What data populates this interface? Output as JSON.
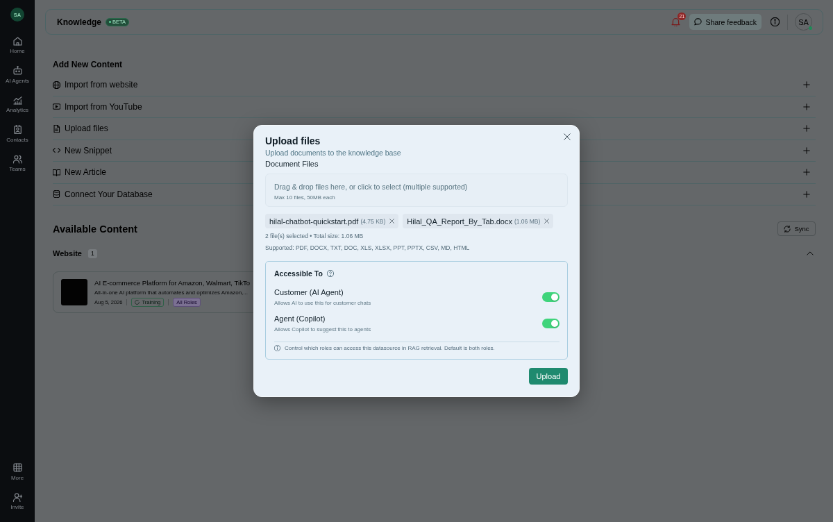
{
  "sidebar": {
    "avatar": "SA",
    "items": [
      {
        "label": "Home"
      },
      {
        "label": "AI Agents"
      },
      {
        "label": "Analytics"
      },
      {
        "label": "Contacts"
      },
      {
        "label": "Teams"
      }
    ],
    "bottom_items": [
      {
        "label": "More"
      },
      {
        "label": "Invite"
      }
    ]
  },
  "header": {
    "title": "Knowledge",
    "badge": "BETA",
    "notification_count": "21",
    "feedback_button": "Share feedback",
    "avatar": "SA",
    "online": true
  },
  "add_content": {
    "title": "Add New Content",
    "options": [
      {
        "label": "Import from website"
      },
      {
        "label": "Import from YouTube"
      },
      {
        "label": "Upload files"
      },
      {
        "label": "New Snippet"
      },
      {
        "label": "New Article"
      },
      {
        "label": "Connect Your Database"
      }
    ]
  },
  "available_content": {
    "title": "Available Content",
    "sync_button": "Sync",
    "groups": [
      {
        "label": "Website",
        "count": "1",
        "expanded": true,
        "items": [
          {
            "title": "AI E-commerce Platform for Amazon, Walmart, TikTo",
            "description": "All-in-one AI platform that automates and optimizes Amazon,...",
            "date": "Aug 5, 2026",
            "status": "Training",
            "role": "All Roles"
          }
        ]
      }
    ]
  },
  "dialog": {
    "title": "Upload files",
    "subtitle": "Upload documents to the knowledge base",
    "field_label": "Document Files",
    "dropzone": {
      "text": "Drag & drop files here, or click to select (multiple supported)",
      "hint": "Max 10 files, 50MB each"
    },
    "files": [
      {
        "name": "hilal-chatbot-quickstart.pdf",
        "size": "(4.75 KB)"
      },
      {
        "name": "Hilal_QA_Report_By_Tab.docx",
        "size": "(1.06 MB)"
      }
    ],
    "summary": "2 file(s) selected • Total size: 1.06 MB",
    "supported": "Supported: PDF, DOCX, TXT, DOC, XLS, XLSX, PPT, PPTX, CSV, MD, HTML",
    "access": {
      "title": "Accessible To",
      "roles": [
        {
          "name": "Customer (AI Agent)",
          "description": "Allows AI to use this for customer chats",
          "on": true
        },
        {
          "name": "Agent (Copilot)",
          "description": "Allows Copilot to suggest this to agents",
          "on": true
        }
      ],
      "note": "Control which roles can access this datasource in RAG retrieval. Default is both roles."
    },
    "upload_button": "Upload"
  }
}
